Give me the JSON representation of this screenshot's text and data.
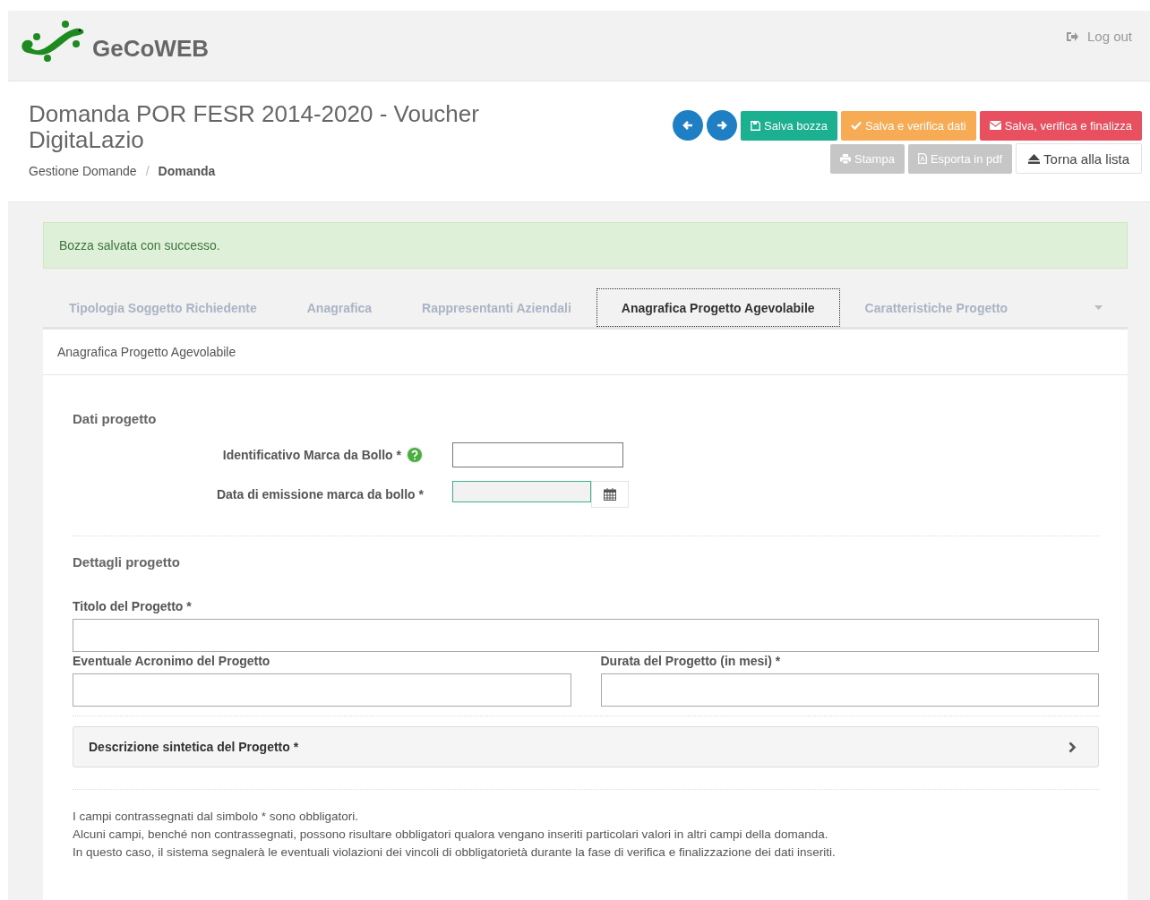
{
  "header": {
    "brand": "GeCoWEB",
    "logout": "Log out"
  },
  "title": "Domanda POR FESR 2014-2020 - Voucher DigitaLazio",
  "breadcrumb_separator": "/",
  "breadcrumb": [
    {
      "label": "Gestione Domande",
      "current": false
    },
    {
      "label": "Domanda",
      "current": true
    }
  ],
  "nav_buttons": [
    {
      "kind": "prev"
    },
    {
      "kind": "next"
    }
  ],
  "actions": [
    {
      "kind": "save",
      "label": "Salva bozza"
    },
    {
      "kind": "verify",
      "label": "Salva e verifica dati"
    },
    {
      "kind": "finalize",
      "label": "Salva, verifica e finalizza"
    }
  ],
  "actions2": [
    {
      "kind": "print",
      "label": "Stampa",
      "disabled": true
    },
    {
      "kind": "export",
      "label": "Esporta in pdf",
      "disabled": true
    },
    {
      "kind": "back",
      "label": "Torna alla lista"
    }
  ],
  "alert": "Bozza salvata con successo.",
  "tabs": [
    {
      "label": "Tipologia Soggetto Richiedente",
      "selected": false
    },
    {
      "label": "Anagrafica",
      "selected": false
    },
    {
      "label": "Rappresentanti Aziendali",
      "selected": false
    },
    {
      "label": "Anagrafica Progetto Agevolabile",
      "selected": true
    },
    {
      "label": "Caratteristiche Progetto",
      "selected": false
    }
  ],
  "panel": {
    "heading": "Anagrafica Progetto Agevolabile",
    "section1": {
      "title": "Dati progetto",
      "fields": [
        {
          "kind": "text",
          "label": "Identificativo Marca da Bollo *",
          "help": true
        },
        {
          "kind": "date",
          "label": "Data di emissione marca da bollo *",
          "help": false
        }
      ]
    },
    "section2": {
      "title": "Dettagli progetto",
      "title_field": "Titolo del Progetto *",
      "acronym_field": "Eventuale Acronimo del Progetto",
      "duration_field": "Durata del Progetto (in mesi) *",
      "collapsible": {
        "label": "Descrizione sintetica del Progetto *",
        "expanded": false
      }
    },
    "notes": [
      "I campi contrassegnati dal simbolo * sono obbligatori.",
      "Alcuni campi, benché non contrassegnati, possono risultare obbligatori qualora vengano inseriti particolari valori in altri campi della domanda.",
      "In questo caso, il sistema segnalerà le eventuali violazioni dei vincoli di obbligatorietà durante la fase di verifica e finalizzazione dei dati inseriti."
    ]
  }
}
